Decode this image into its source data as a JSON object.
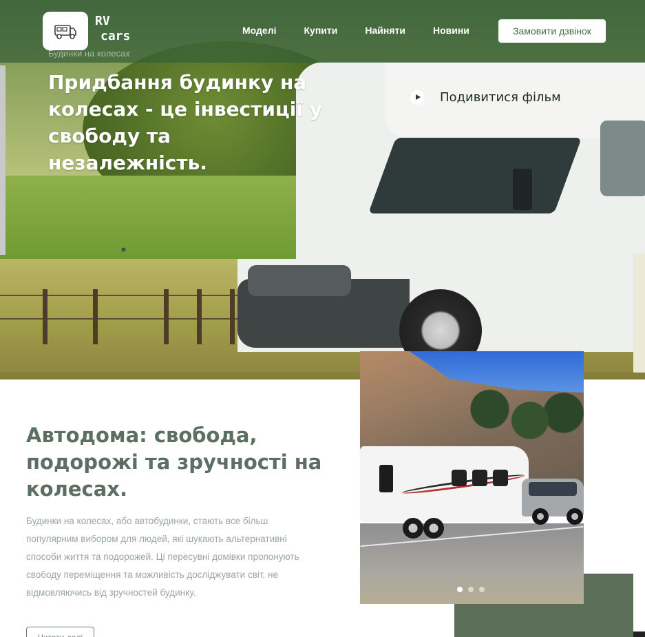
{
  "header": {
    "logo_line1": "RV",
    "logo_line2": "cars",
    "tagline": "Будинки на колесах",
    "nav": [
      "Моделі",
      "Купити",
      "Найняти",
      "Новини"
    ],
    "cta_label": "Замовити дзвінок"
  },
  "hero": {
    "title": "Придбання будинку на колесах - це інвестиції у свободу та незалежність.",
    "video_label": "Подивитися фільм"
  },
  "about": {
    "title": "Автодома: свобода, подорожі та зручності на колесах.",
    "text": "Будинки на колесах, або автобудинки, стають все більш популярним вибором для людей, які шукають альтернативні способи життя та подорожей. Ці пересувні домівки пропонують свободу переміщення та можливість досліджувати світ, не відмовляючись від зручностей будинку.",
    "button_label": "Читати далі"
  },
  "slider": {
    "dot_count": 3,
    "active_index": 0
  },
  "colors": {
    "header_overlay": "#386038",
    "accent_green": "#5a6e58",
    "title_text": "#5d6e63",
    "body_text": "#9aa7a0"
  },
  "icons": {
    "logo": "rv-camper-icon",
    "video": "play-icon"
  }
}
